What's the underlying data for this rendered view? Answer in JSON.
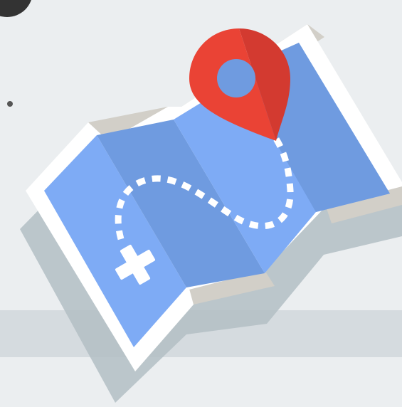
{
  "illustration": {
    "subject": "folded-map-icon",
    "pin": "map-pin-icon",
    "route": "dotted-route-icon",
    "destination": "x-mark-icon",
    "colors": {
      "background": "#ebeef0",
      "ground_band": "#d5dbdf",
      "shadow": "#bcc6cc",
      "map_border": "#ffffff",
      "map_edge_fold": "#d2cfc8",
      "map_panel_dark": "#6f9be0",
      "map_panel_light": "#7eabf5",
      "pin_light": "#ea4335",
      "pin_dark": "#d33a30",
      "pin_hole": "#6f9be0",
      "route": "#ffffff",
      "top_left_circle": "#333333",
      "bullet": "#555555"
    }
  }
}
